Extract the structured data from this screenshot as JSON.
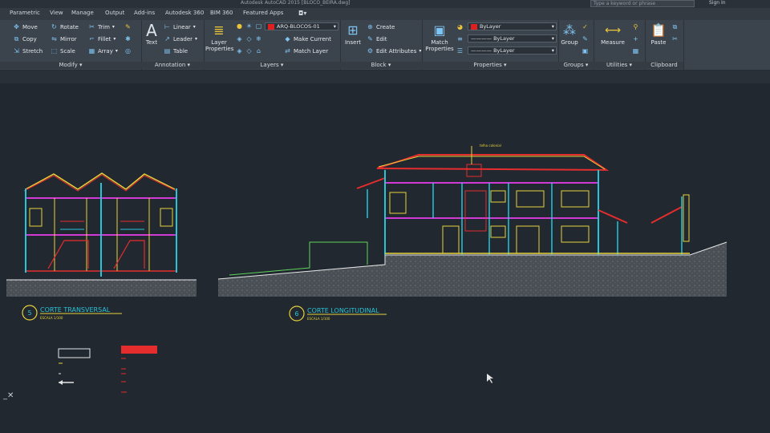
{
  "app": {
    "title": "Autodesk AutoCAD 2015  [BLOCO_BEIRA.dwg]",
    "search_placeholder": "Type a keyword or phrase",
    "signin": "Sign In"
  },
  "tabs": [
    "Parametric",
    "View",
    "Manage",
    "Output",
    "Add-ins",
    "Autodesk 360",
    "BIM 360",
    "Featured Apps"
  ],
  "ribbon": {
    "modify": {
      "label": "Modify",
      "move": "Move",
      "rotate": "Rotate",
      "trim": "Trim",
      "copy": "Copy",
      "mirror": "Mirror",
      "fillet": "Fillet",
      "stretch": "Stretch",
      "scale": "Scale",
      "array": "Array"
    },
    "annotation": {
      "label": "Annotation",
      "text": "Text",
      "linear": "Linear",
      "leader": "Leader",
      "table": "Table"
    },
    "layers": {
      "label": "Layers",
      "layer_properties": "Layer Properties",
      "current_layer": "ARQ-BLOCOS-01",
      "make_current": "Make Current",
      "match_layer": "Match Layer"
    },
    "block": {
      "label": "Block",
      "insert": "Insert",
      "create": "Create",
      "edit": "Edit",
      "edit_attributes": "Edit Attributes"
    },
    "properties": {
      "label": "Properties",
      "match_properties": "Match Properties",
      "color": "ByLayer",
      "linetype": "ByLayer",
      "lineweight": "ByLayer"
    },
    "groups": {
      "label": "Groups",
      "group": "Group"
    },
    "utilities": {
      "label": "Utilities",
      "measure": "Measure"
    },
    "clipboard": {
      "label": "Clipboard",
      "paste": "Paste"
    }
  },
  "drawing": {
    "section5": {
      "number": "5",
      "title": "CORTE TRANSVERSAL",
      "scale": "ESCALA 1/100"
    },
    "section6": {
      "number": "6",
      "title": "CORTE LONGITUDINAL",
      "scale": "ESCALA 1/100"
    },
    "roof_label": "telha colonial"
  },
  "colors": {
    "cyan": "#29c4d8",
    "yellow": "#e8d23a",
    "magenta": "#d23ad6",
    "red": "#e52d2d",
    "white": "#e6e6e6",
    "green": "#5fd45a",
    "bg": "#212830"
  }
}
